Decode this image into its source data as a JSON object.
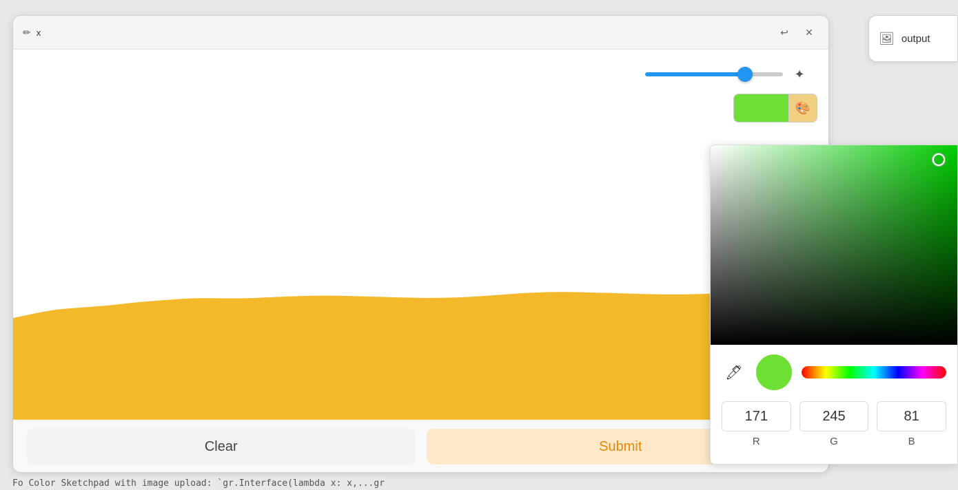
{
  "window": {
    "title": "x",
    "title_icon": "✏️"
  },
  "toolbar": {
    "slider_value": 75,
    "magic_wand_label": "✨",
    "palette_icon": "🎨"
  },
  "color_picker": {
    "r_value": "171",
    "g_value": "245",
    "b_value": "81",
    "r_label": "R",
    "g_label": "G",
    "b_label": "B",
    "eyedropper_icon": "💉",
    "current_color": "#6EE033"
  },
  "buttons": {
    "clear_label": "Clear",
    "submit_label": "Submit"
  },
  "output_panel": {
    "label": "output",
    "icon": "🖼"
  },
  "bottom_text": "Fo Color Sketchpad with image upload: `gr.Interface(lambda x: x,...gr",
  "window_controls": {
    "undo_icon": "↩",
    "close_icon": "✕"
  }
}
